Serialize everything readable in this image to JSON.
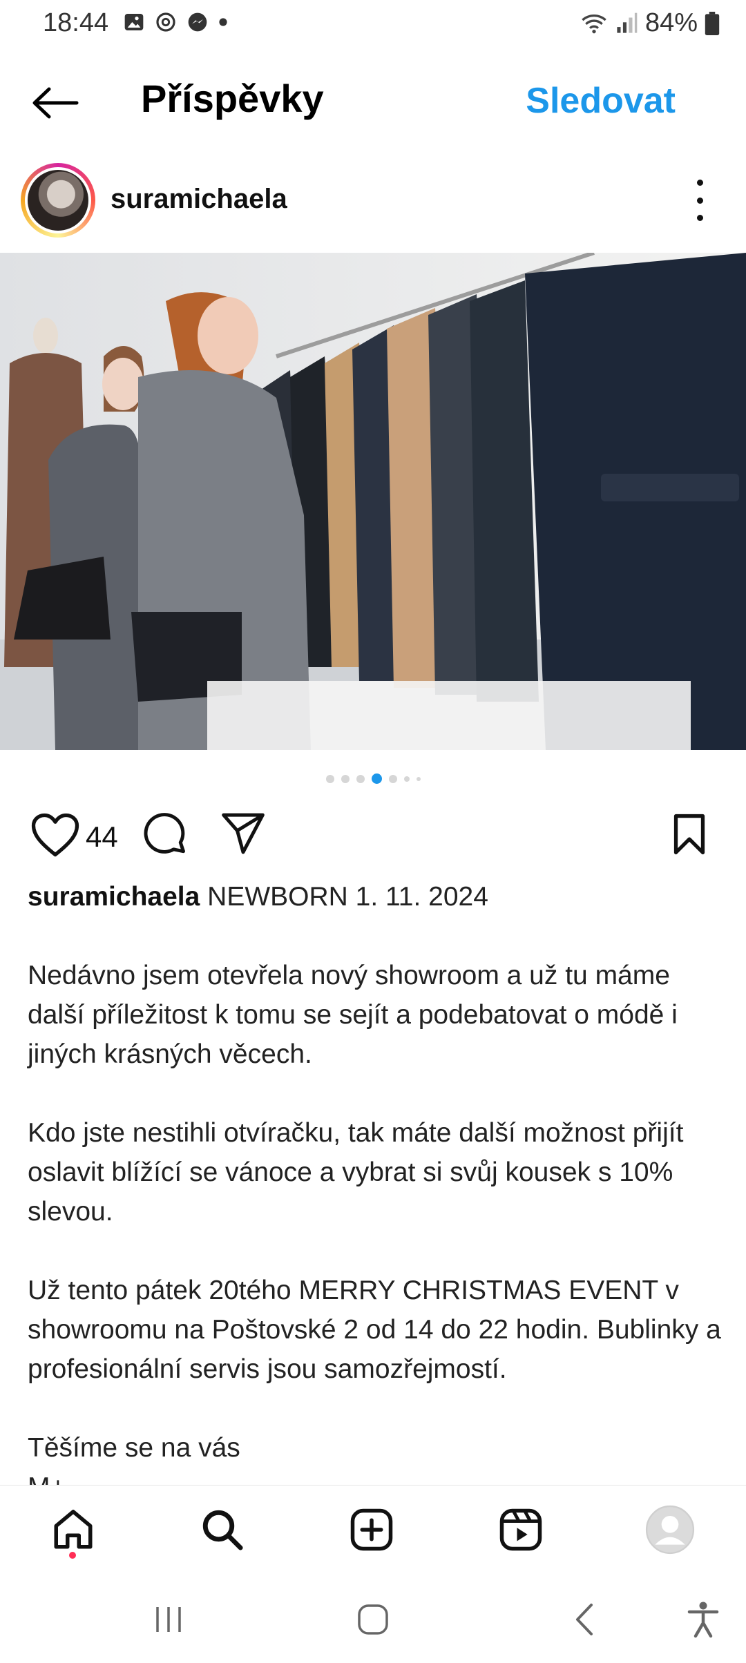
{
  "status_bar": {
    "time": "18:44",
    "battery": "84%",
    "left_icons": [
      "gallery-icon",
      "sync-icon",
      "messenger-icon",
      "dot-icon"
    ],
    "right_icons": [
      "wifi-icon",
      "signal-icon",
      "battery-icon"
    ]
  },
  "header": {
    "title": "Příspěvky",
    "follow_label": "Sledovat"
  },
  "post": {
    "username": "suramichaela",
    "carousel": {
      "total": 7,
      "active_index": 3
    },
    "likes": "44",
    "caption": {
      "username": "suramichaela",
      "lines": [
        " NEWBORN 1. 11. 2024",
        "",
        "Nedávno jsem otevřela nový showroom a už tu máme další příležitost k tomu se sejít a podebatovat o módě i jiných krásných věcech.",
        "",
        "Kdo jste nestihli otvíračku, tak máte další možnost přijít oslavit blížící se vánoce a vybrat si svůj kousek s 10% slevou.",
        "",
        "Už tento pátek 20tého MERRY CHRISTMAS EVENT v showroomu na Poštovské 2 od 14 do 22 hodin. Bublinky a profesionální servis jsou samozřejmostí.",
        "",
        "Těšíme se na vás",
        "M+"
      ]
    }
  },
  "colors": {
    "accent": "#1c97ea",
    "notification": "#ff2d55"
  }
}
